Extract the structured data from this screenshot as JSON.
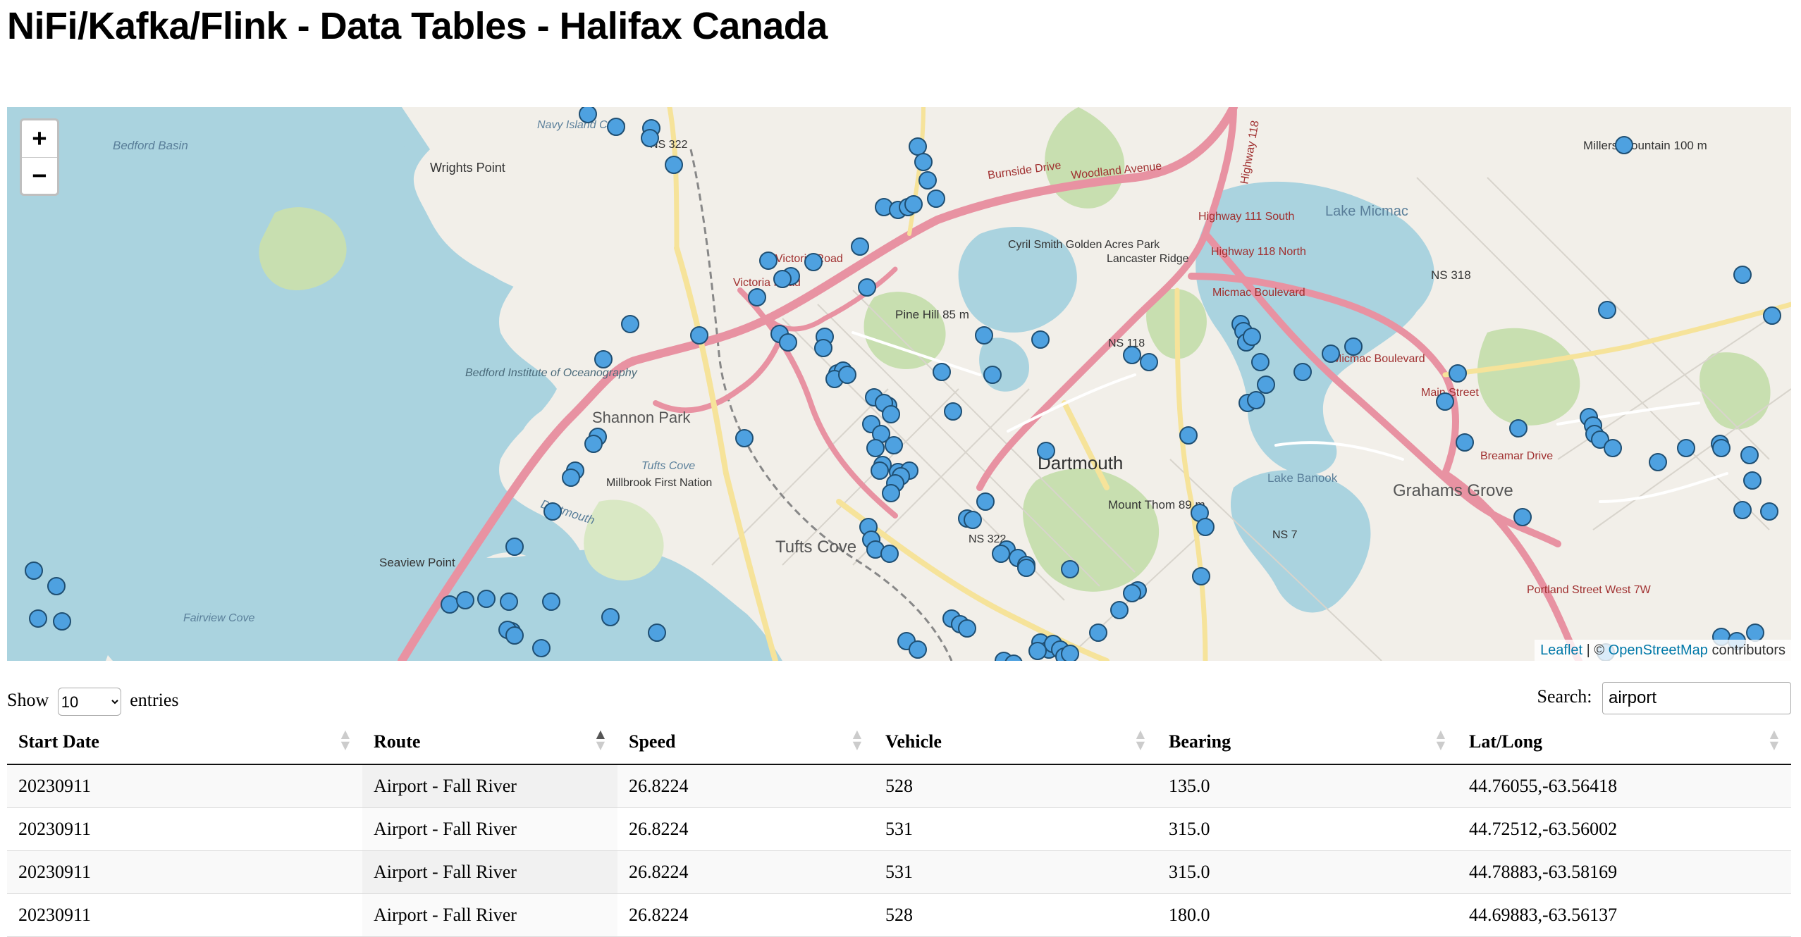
{
  "page": {
    "title": "NiFi/Kafka/Flink - Data Tables - Halifax Canada"
  },
  "map": {
    "zoom_in": "+",
    "zoom_out": "−",
    "attribution": {
      "leaflet": "Leaflet",
      "separator": " | © ",
      "osm": "OpenStreetMap",
      "suffix": " contributors"
    },
    "colors": {
      "water": "#aad3df",
      "land": "#f2efe9",
      "green": "#c8dfb0",
      "road": "#e892a2",
      "marker": "#4ea1e0"
    },
    "labels": {
      "bedford_basin": "Bedford Basin",
      "navy_island_cove": "Navy Island Cove",
      "wrights_point": "Wrights Point",
      "ns322_top": "NS 322",
      "burnside_drive": "Burnside Drive",
      "woodland_avenue": "Woodland Avenue",
      "highway_118": "Highway 118",
      "millers_mountain": "Millers Mountain 100 m",
      "lake_micmac": "Lake Micmac",
      "hwy_111_south": "Highway 111 South",
      "hwy_118_north": "Highway 118 North",
      "cyril_smith": "Cyril Smith Golden Acres Park",
      "lancaster_ridge": "Lancaster Ridge",
      "ns318": "NS 318",
      "micmac_blvd": "Micmac Boulevard",
      "victoria_road": "Victoria Road",
      "pine_hill": "Pine Hill 85 m",
      "bedford_institute": "Bedford Institute of Oceanography",
      "shannon_park": "Shannon Park",
      "ns118": "NS 118",
      "main_street": "Main Street",
      "breamar_drive": "Breamar Drive",
      "tufts_cove_small": "Tufts Cove",
      "millbrook": "Millbrook First Nation",
      "dartmouth_water": "Dartmouth",
      "dartmouth": "Dartmouth",
      "mount_thom": "Mount Thom 89 m",
      "lake_banook": "Lake Banook",
      "grahams_grove": "Grahams Grove",
      "ns7": "NS 7",
      "ns322_bottom": "NS 322",
      "tufts_cove": "Tufts Cove",
      "seaview_point": "Seaview Point",
      "fairview_cove": "Fairview Cove",
      "portland_street": "Portland Street West 7W"
    }
  },
  "table_controls": {
    "show_label": "Show",
    "entries_option": "10",
    "entries_label": "entries",
    "search_label": "Search:",
    "search_value": "airport"
  },
  "table": {
    "headers": [
      "Start Date",
      "Route",
      "Speed",
      "Vehicle",
      "Bearing",
      "Lat/Long"
    ],
    "sorted_column": "Route",
    "rows": [
      [
        "20230911",
        "Airport - Fall River",
        "26.8224",
        "528",
        "135.0",
        "44.76055,-63.56418"
      ],
      [
        "20230911",
        "Airport - Fall River",
        "26.8224",
        "531",
        "315.0",
        "44.72512,-63.56002"
      ],
      [
        "20230911",
        "Airport - Fall River",
        "26.8224",
        "531",
        "315.0",
        "44.78883,-63.58169"
      ],
      [
        "20230911",
        "Airport - Fall River",
        "26.8224",
        "528",
        "180.0",
        "44.69883,-63.56137"
      ]
    ]
  }
}
